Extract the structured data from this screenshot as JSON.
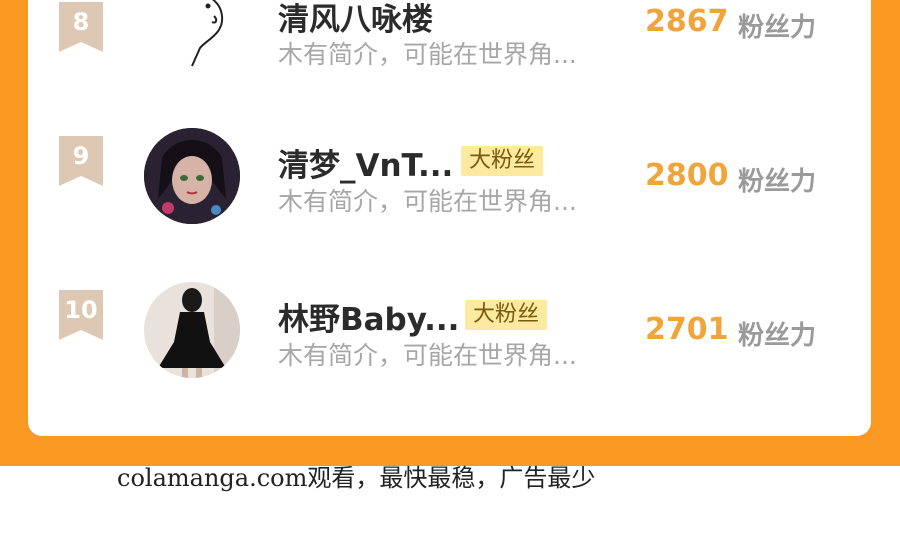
{
  "ranking": [
    {
      "rank": "8",
      "name": "清风八咏楼",
      "badge": "",
      "desc": "木有简介，可能在世界角...",
      "fans": "2867",
      "fans_unit": "粉丝力",
      "avatar": "bear-sketch"
    },
    {
      "rank": "9",
      "name": "清梦_VnT...",
      "badge": "大粉丝",
      "desc": "木有简介，可能在世界角...",
      "fans": "2800",
      "fans_unit": "粉丝力",
      "avatar": "anime-girl"
    },
    {
      "rank": "10",
      "name": "林野Baby...",
      "badge": "大粉丝",
      "desc": "木有简介，可能在世界角...",
      "fans": "2701",
      "fans_unit": "粉丝力",
      "avatar": "black-dress"
    }
  ],
  "footer": {
    "text": "colamanga.com观看，最快最稳，广告最少"
  },
  "colors": {
    "frame": "#fb9a22",
    "fans": "#f0a43a",
    "badge_bg": "#fde9a0",
    "rank_ribbon": "#dcc8b3"
  }
}
